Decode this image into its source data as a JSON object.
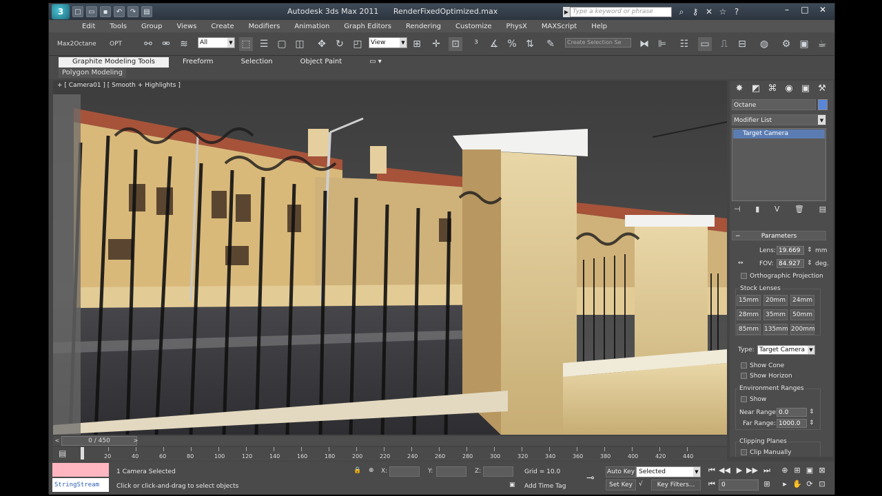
{
  "title": {
    "app": "Autodesk 3ds Max 2011",
    "file": "RenderFixedOptimized.max"
  },
  "search": {
    "placeholder": "Type a keyword or phrase"
  },
  "menu": [
    "Edit",
    "Tools",
    "Group",
    "Views",
    "Create",
    "Modifiers",
    "Animation",
    "Graph Editors",
    "Rendering",
    "Customize",
    "PhysX",
    "MAXScript",
    "Help"
  ],
  "toolbar": {
    "plugin_label": "Max2Octane",
    "opt_label": "OPT",
    "filter_value": "All",
    "refcoord_value": "View",
    "selection_set_placeholder": "Create Selection Se"
  },
  "ribbon": {
    "tabs": [
      "Graphite Modeling Tools",
      "Freeform",
      "Selection",
      "Object Paint"
    ],
    "sub": "Polygon Modeling"
  },
  "viewport": {
    "label": "+ [ Camera01 ] [ Smooth + Highlights ]"
  },
  "command_panel": {
    "object_name": "Octane",
    "object_color": "#5a86d8",
    "modifier_list": "Modifier List",
    "stack_item": "Target Camera",
    "rollout": "Parameters",
    "lens_label": "Lens:",
    "lens_value": "19.669",
    "lens_unit": "mm",
    "fov_label": "FOV:",
    "fov_value": "84.927",
    "fov_unit": "deg.",
    "ortho": "Orthographic Projection",
    "stock_lenses": "Stock Lenses",
    "lenses": [
      "15mm",
      "20mm",
      "24mm",
      "28mm",
      "35mm",
      "50mm",
      "85mm",
      "135mm",
      "200mm"
    ],
    "type_label": "Type:",
    "type_value": "Target Camera",
    "show_cone": "Show Cone",
    "show_horizon": "Show Horizon",
    "env_ranges": "Environment Ranges",
    "env_show": "Show",
    "near_label": "Near Range:",
    "near_value": "0.0",
    "far_label": "Far Range:",
    "far_value": "1000.0",
    "clipping": "Clipping Planes",
    "clip_manually": "Clip Manually"
  },
  "timeslider": {
    "position": "0 / 450",
    "current_frame": 0,
    "total_frames": 450
  },
  "trackbar": {
    "ticks": [
      "20",
      "40",
      "60",
      "80",
      "100",
      "120",
      "140",
      "160",
      "180",
      "200",
      "220",
      "240",
      "260",
      "280",
      "300",
      "320",
      "340",
      "360",
      "380",
      "400",
      "420",
      "440"
    ]
  },
  "status": {
    "maxscript": "StringStream",
    "selected": "1 Camera Selected",
    "prompt": "Click or click-and-drag to select objects",
    "x_label": "X:",
    "y_label": "Y:",
    "z_label": "Z:",
    "grid": "Grid = 10.0",
    "add_time_tag": "Add Time Tag",
    "auto_key": "Auto Key",
    "set_key": "Set Key",
    "key_mode": "Selected",
    "key_filters": "Key Filters...",
    "frame": "0"
  }
}
